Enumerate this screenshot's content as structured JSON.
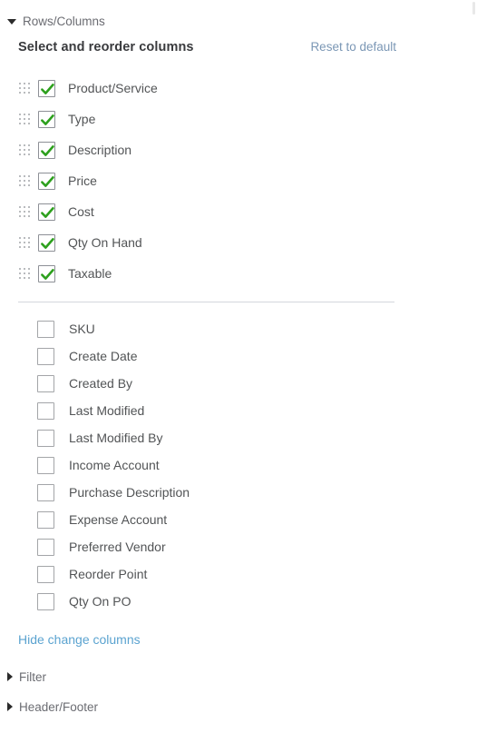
{
  "sections": {
    "rows_columns": {
      "label": "Rows/Columns",
      "expanded": true,
      "icon": "chevron-down-icon"
    },
    "filter": {
      "label": "Filter",
      "expanded": false,
      "icon": "chevron-right-icon"
    },
    "header_footer": {
      "label": "Header/Footer",
      "expanded": false,
      "icon": "chevron-right-icon"
    }
  },
  "panel": {
    "title": "Select and reorder columns",
    "reset_label": "Reset to default",
    "hide_label": "Hide change columns"
  },
  "selected_columns": [
    {
      "label": "Product/Service",
      "checked": true,
      "handle": "drag-handle-icon"
    },
    {
      "label": "Type",
      "checked": true,
      "handle": "drag-handle-icon"
    },
    {
      "label": "Description",
      "checked": true,
      "handle": "drag-handle-icon"
    },
    {
      "label": "Price",
      "checked": true,
      "handle": "drag-handle-icon"
    },
    {
      "label": "Cost",
      "checked": true,
      "handle": "drag-handle-icon"
    },
    {
      "label": "Qty On Hand",
      "checked": true,
      "handle": "drag-handle-icon"
    },
    {
      "label": "Taxable",
      "checked": true,
      "handle": "drag-handle-icon"
    }
  ],
  "available_columns": [
    {
      "label": "SKU",
      "checked": false
    },
    {
      "label": "Create Date",
      "checked": false
    },
    {
      "label": "Created By",
      "checked": false
    },
    {
      "label": "Last Modified",
      "checked": false
    },
    {
      "label": "Last Modified By",
      "checked": false
    },
    {
      "label": "Income Account",
      "checked": false
    },
    {
      "label": "Purchase Description",
      "checked": false
    },
    {
      "label": "Expense Account",
      "checked": false
    },
    {
      "label": "Preferred Vendor",
      "checked": false
    },
    {
      "label": "Reorder Point",
      "checked": false
    },
    {
      "label": "Qty On PO",
      "checked": false
    }
  ],
  "colors": {
    "checkmark_green": "#2da01d",
    "link_blue": "#5ba3d0",
    "reset_link_blue": "#7b97b5",
    "label_gray": "#525456",
    "section_gray": "#6b6c72",
    "divider": "#d4d7dc"
  }
}
